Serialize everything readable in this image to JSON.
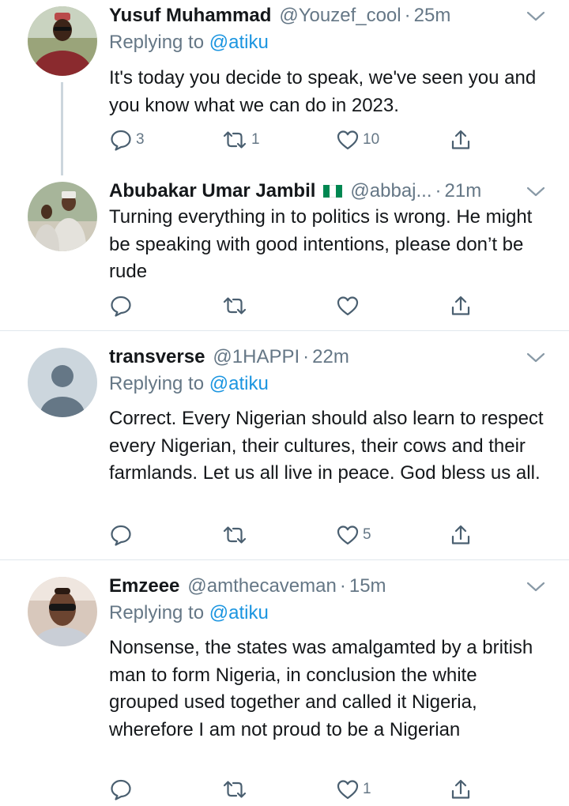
{
  "tweets": [
    {
      "name": "Yusuf Muhammad",
      "handle": "@Youzef_cool",
      "sep": "·",
      "time": "25m",
      "reply_prefix": "Replying to",
      "reply_to": "@atiku",
      "text": "It's today you decide to speak, we've seen you and you know what we can do in 2023.",
      "replies": "3",
      "retweets": "1",
      "likes": "10"
    },
    {
      "name": "Abubakar Umar Jambil",
      "flag": "nigeria-flag",
      "handle": "@abbaj...",
      "sep": "·",
      "time": "21m",
      "text": "Turning everything in to politics is wrong. He might be speaking with good intentions, please don’t be rude"
    },
    {
      "name": "transverse",
      "handle": "@1HAPPI",
      "sep": "·",
      "time": "22m",
      "reply_prefix": "Replying to",
      "reply_to": "@atiku",
      "text": "Correct. Every Nigerian should also learn to respect every Nigerian, their cultures, their cows and their farmlands. Let us all live in peace. God bless us all.",
      "likes": "5"
    },
    {
      "name": "Emzeee",
      "handle": "@amthecaveman",
      "sep": "·",
      "time": "15m",
      "reply_prefix": "Replying to",
      "reply_to": "@atiku",
      "text": "Nonsense, the states was amalgamted by a british man to form Nigeria, in conclusion the white grouped used together and called it Nigeria, wherefore I am not proud to be a Nigerian",
      "likes": "1"
    }
  ],
  "colors": {
    "accent": "#1b95e0",
    "muted": "#657786",
    "icon": "#4a5f70",
    "divider": "#e1e8ed",
    "flag_green": "#008751"
  },
  "icons": [
    "reply-icon",
    "retweet-icon",
    "like-icon",
    "share-icon",
    "chevron-down-icon"
  ]
}
